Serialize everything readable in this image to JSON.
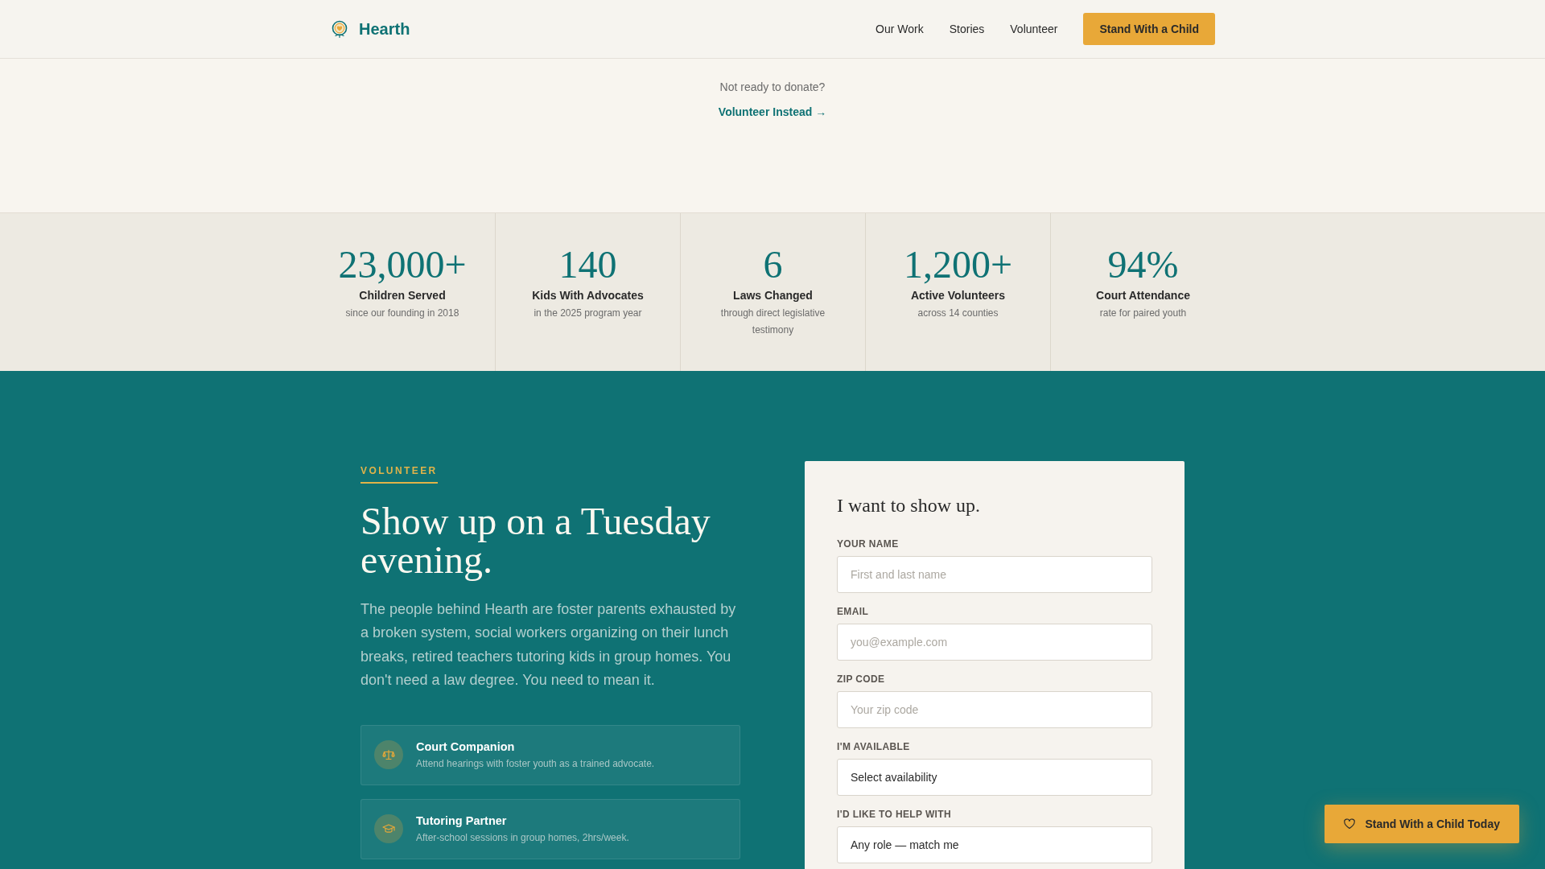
{
  "header": {
    "brand": "Hearth",
    "nav": [
      {
        "label": "Our Work"
      },
      {
        "label": "Stories"
      },
      {
        "label": "Volunteer"
      }
    ],
    "cta": "Stand With a Child"
  },
  "donate_prompt": {
    "text": "Not ready to donate?",
    "link": "Volunteer Instead →"
  },
  "stats": [
    {
      "value": "23,000+",
      "label": "Children Served",
      "detail": "since our founding in 2018"
    },
    {
      "value": "140",
      "label": "Kids With Advocates",
      "detail": "in the 2025 program year"
    },
    {
      "value": "6",
      "label": "Laws Changed",
      "detail": "through direct legislative testimony"
    },
    {
      "value": "1,200+",
      "label": "Active Volunteers",
      "detail": "across 14 counties"
    },
    {
      "value": "94%",
      "label": "Court Attendance",
      "detail": "rate for paired youth"
    }
  ],
  "volunteer": {
    "eyebrow": "VOLUNTEER",
    "heading": "Show up on a Tuesday evening.",
    "body": "The people behind Hearth are foster parents exhausted by a broken system, social workers organizing on their lunch breaks, retired teachers tutoring kids in group homes. You don't need a law degree. You need to mean it.",
    "roles": [
      {
        "kind": "court",
        "title": "Court Companion",
        "description": "Attend hearings with foster youth as a trained advocate."
      },
      {
        "kind": "tutoring",
        "title": "Tutoring Partner",
        "description": "After-school sessions in group homes, 2hrs/week."
      }
    ]
  },
  "form": {
    "title": "I want to show up.",
    "fields": [
      {
        "kind": "text",
        "label": "YOUR NAME",
        "placeholder": "First and last name"
      },
      {
        "kind": "text",
        "label": "EMAIL",
        "placeholder": "you@example.com"
      },
      {
        "kind": "text",
        "label": "ZIP CODE",
        "placeholder": "Your zip code"
      },
      {
        "kind": "select",
        "label": "I'M AVAILABLE",
        "value": "Select availability"
      },
      {
        "kind": "select",
        "label": "I'D LIKE TO HELP WITH",
        "value": "Any role — match me"
      }
    ]
  },
  "floating_button": {
    "label": "Stand With a Child Today"
  }
}
